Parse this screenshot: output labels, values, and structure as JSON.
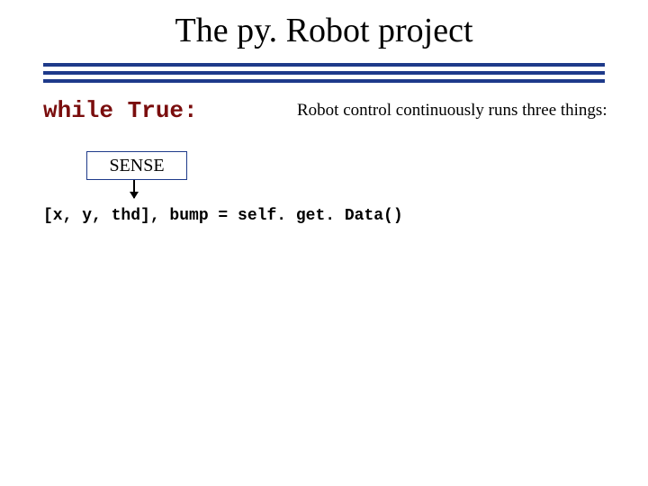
{
  "title": "The py. Robot project",
  "while_label": "while True:",
  "subtitle": "Robot control continuously runs three things:",
  "sense_label": "SENSE",
  "code_line": "[x, y, thd], bump = self. get. Data()"
}
